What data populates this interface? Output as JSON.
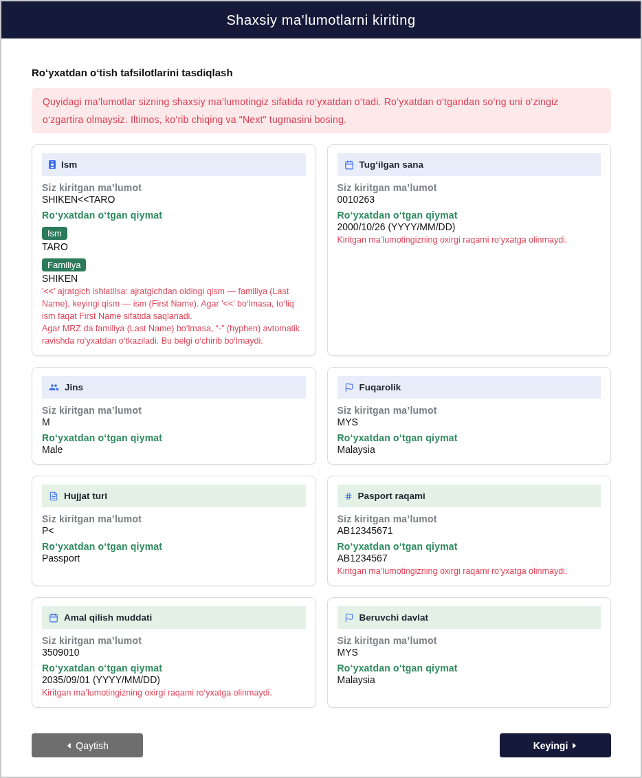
{
  "header": {
    "title": "Shaxsiy ma'lumotlarni kiriting"
  },
  "section_title": "Ro‘yxatdan o‘tish tafsilotlarini tasdiqlash",
  "alert": "Quyidagi ma’lumotlar sizning shaxsiy ma’lumotingiz sifatida ro‘yxatdan o‘tadi. Ro‘yxatdan o‘tgandan so‘ng uni o‘zingiz o‘zgartira olmaysiz. Iltimos, ko‘rib chiqing va \"Next\" tugmasini bosing.",
  "fields": [
    {
      "kind": "name",
      "title": "Ism",
      "color": "#e9ecf9",
      "input_label": "Siz kiritgan ma’lumot",
      "input_value": "SHIKEN<<TARO",
      "registered_label": "Ro‘yxatdan o‘tgan qiymat",
      "registered": [
        {
          "tag": "Ism",
          "value": "TARO"
        },
        {
          "tag": "Familiya",
          "value": "SHIKEN"
        }
      ],
      "notes": [
        "'<<' ajratgich ishlatilsa: ajratgichdan oldingi qism — familiya (Last Name), keyingi qism — ism (First Name). Agar '<<' bo‘lmasa, to‘liq ism faqat First Name sifatida saqlanadi.",
        "Agar MRZ da familiya (Last Name) bo‘lmasa, “-” (hyphen) avtomatik ravishda ro‘yxatdan o‘tkaziladi. Bu belgi o‘chirib bo‘lmaydi."
      ]
    },
    {
      "kind": "date",
      "title": "Tug‘ilgan sana",
      "color": "#e9ecf9",
      "input_label": "Siz kiritgan ma’lumot",
      "input_value": "0010263",
      "registered_label": "Ro‘yxatdan o‘tgan qiymat",
      "registered": [
        {
          "value": "2000/10/26 (YYYY/MM/DD)"
        }
      ],
      "notes": [
        "Kiritgan ma’lumotingizning oxirgi raqami ro‘yxatga olinmaydi."
      ]
    },
    {
      "kind": "gender",
      "title": "Jins",
      "color": "#e9ecf9",
      "input_label": "Siz kiritgan ma’lumot",
      "input_value": "M",
      "registered_label": "Ro‘yxatdan o‘tgan qiymat",
      "registered": [
        {
          "value": "Male"
        }
      ]
    },
    {
      "kind": "country",
      "title": "Fuqarolik",
      "color": "#e9ecf9",
      "input_label": "Siz kiritgan ma’lumot",
      "input_value": "MYS",
      "registered_label": "Ro‘yxatdan o‘tgan qiymat",
      "registered": [
        {
          "value": "Malaysia"
        }
      ]
    },
    {
      "kind": "document",
      "title": "Hujjat turi",
      "color": "#e3f1e6",
      "input_label": "Siz kiritgan ma’lumot",
      "input_value": "P<",
      "registered_label": "Ro‘yxatdan o‘tgan qiymat",
      "registered": [
        {
          "value": "Passport"
        }
      ]
    },
    {
      "kind": "number",
      "title": "Pasport raqami",
      "color": "#e3f1e6",
      "input_label": "Siz kiritgan ma’lumot",
      "input_value": "AB12345671",
      "registered_label": "Ro‘yxatdan o‘tgan qiymat",
      "registered": [
        {
          "value": "AB1234567"
        }
      ],
      "notes": [
        "Kiritgan ma’lumotingizning oxirgi raqami ro‘yxatga olinmaydi."
      ]
    },
    {
      "kind": "date",
      "title": "Amal qilish muddati",
      "color": "#e3f1e6",
      "input_label": "Siz kiritgan ma’lumot",
      "input_value": "3509010",
      "registered_label": "Ro‘yxatdan o‘tgan qiymat",
      "registered": [
        {
          "value": "2035/09/01 (YYYY/MM/DD)"
        }
      ],
      "notes": [
        "Kiritgan ma’lumotingizning oxirgi raqami ro‘yxatga olinmaydi."
      ]
    },
    {
      "kind": "country",
      "title": "Beruvchi davlat",
      "color": "#e3f1e6",
      "input_label": "Siz kiritgan ma’lumot",
      "input_value": "MYS",
      "registered_label": "Ro‘yxatdan o‘tgan qiymat",
      "registered": [
        {
          "value": "Malaysia"
        }
      ]
    }
  ],
  "buttons": [
    {
      "kind": "back",
      "label": "Qaytish"
    },
    {
      "kind": "next",
      "label": "Keyingi"
    }
  ]
}
